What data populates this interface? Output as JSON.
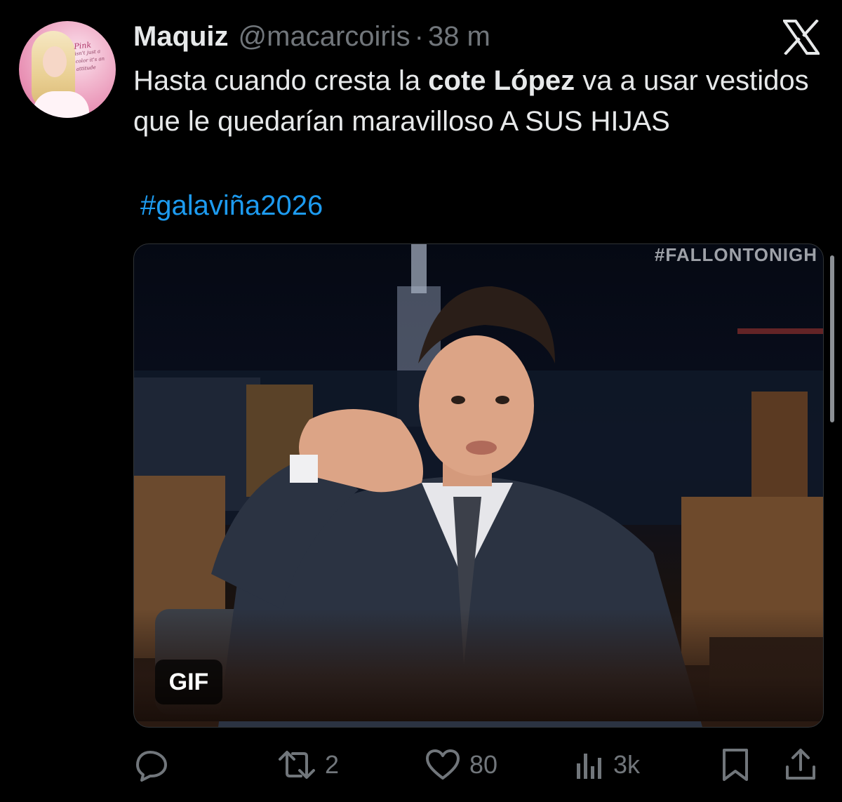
{
  "author": {
    "name": "Maquiz",
    "handle": "@macarcoiris",
    "separator": "·",
    "time": "38 m",
    "avatar_text": "Pink",
    "avatar_subtext": "isn't just a color it's an attitude"
  },
  "brand": {
    "icon": "x-logo-icon"
  },
  "tweet": {
    "text_part1": "Hasta cuando cresta la ",
    "text_bold": "cote López",
    "text_part2": " va a usar vestidos que le quedarían maravilloso A SUS HIJAS",
    "hashtag": "#galaviña2026"
  },
  "media": {
    "watermark": "#FALLONTONIGH",
    "badge": "GIF"
  },
  "actions": {
    "reply": {
      "icon": "reply-icon",
      "count": ""
    },
    "retweet": {
      "icon": "retweet-icon",
      "count": "2"
    },
    "like": {
      "icon": "heart-icon",
      "count": "80"
    },
    "views": {
      "icon": "views-icon",
      "count": "3k"
    },
    "bookmark": {
      "icon": "bookmark-icon"
    },
    "share": {
      "icon": "share-icon"
    }
  },
  "colors": {
    "background": "#000000",
    "text": "#e7e9ea",
    "muted": "#71767b",
    "accent": "#1d9bf0"
  }
}
